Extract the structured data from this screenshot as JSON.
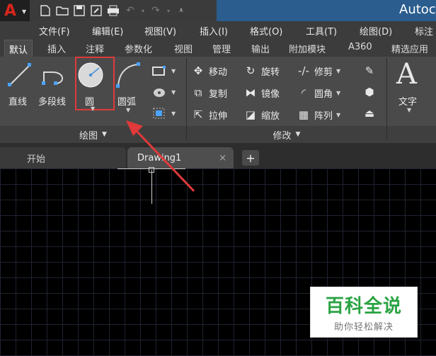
{
  "window": {
    "title": "Autoc"
  },
  "quick_access": [
    "new-icon",
    "open-icon",
    "save-icon",
    "saveas-icon",
    "print-icon",
    "undo-icon",
    "redo-icon",
    "customize-icon"
  ],
  "menu": [
    {
      "label": "文件(F)"
    },
    {
      "label": "编辑(E)"
    },
    {
      "label": "视图(V)"
    },
    {
      "label": "插入(I)"
    },
    {
      "label": "格式(O)"
    },
    {
      "label": "工具(T)"
    },
    {
      "label": "绘图(D)"
    },
    {
      "label": "标注"
    }
  ],
  "ribbon_tabs": [
    {
      "label": "默认"
    },
    {
      "label": "插入"
    },
    {
      "label": "注释"
    },
    {
      "label": "参数化"
    },
    {
      "label": "视图"
    },
    {
      "label": "管理"
    },
    {
      "label": "输出"
    },
    {
      "label": "附加模块"
    },
    {
      "label": "A360"
    },
    {
      "label": "精选应用"
    }
  ],
  "draw_panel": {
    "title": "绘图",
    "line": "直线",
    "polyline": "多段线",
    "circle": "圆",
    "arc": "圆弧"
  },
  "modify_panel": {
    "title": "修改",
    "move": "移动",
    "rotate": "旋转",
    "trim": "修剪",
    "copy": "复制",
    "mirror": "镜像",
    "fillet": "圆角",
    "stretch": "拉伸",
    "scale": "缩放",
    "array": "阵列"
  },
  "annotation_panel": {
    "text": "文字",
    "letter": "A"
  },
  "doc_tabs": {
    "start": "开始",
    "drawing": "Drawing1",
    "close": "×",
    "add": "+"
  },
  "watermark": {
    "title": "百科全说",
    "subtitle": "助你轻松解决"
  },
  "colors": {
    "highlight": "#e03a3a",
    "accent": "#2b5d8e",
    "watermark_green": "#2aa343"
  }
}
